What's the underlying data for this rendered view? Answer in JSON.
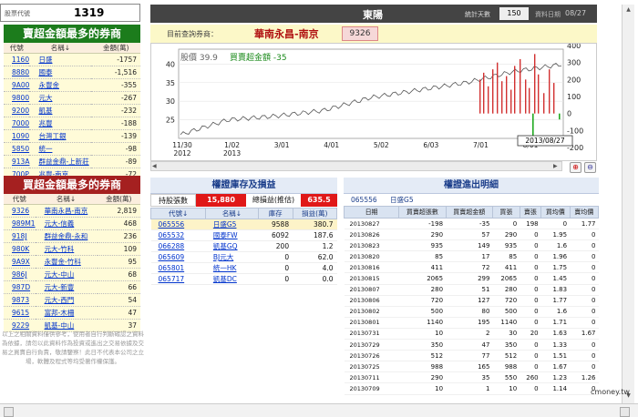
{
  "top": {
    "label": "股票代號",
    "code": "1319"
  },
  "sell_panel": {
    "title": "賣超金額最多的券商",
    "headers": [
      "代號",
      "名稱↓",
      "金額(萬)"
    ],
    "rows": [
      [
        "1160",
        "日盛",
        "-1757"
      ],
      [
        "8880",
        "國泰",
        "-1,516"
      ],
      [
        "9A00",
        "永豐金",
        "-355"
      ],
      [
        "9800",
        "元大",
        "-267"
      ],
      [
        "9200",
        "凱基",
        "-232"
      ],
      [
        "7000",
        "兆豐",
        "-188"
      ],
      [
        "1090",
        "台灣工銀",
        "-139"
      ],
      [
        "5850",
        "統一",
        "-98"
      ],
      [
        "913A",
        "群益金鼎-上新莊",
        "-89"
      ],
      [
        "700P",
        "兆豐-南京",
        "-72"
      ]
    ]
  },
  "buy_panel": {
    "title": "買超金額最多的券商",
    "headers": [
      "代號",
      "名稱↓",
      "金額(萬)"
    ],
    "rows": [
      [
        "9326",
        "華南永昌-南京",
        "2,819"
      ],
      [
        "989M1",
        "元大-信義",
        "468"
      ],
      [
        "918J",
        "群益金鼎-永和",
        "236"
      ],
      [
        "980K",
        "元大-竹科",
        "109"
      ],
      [
        "9A9X",
        "永豐金-竹科",
        "95"
      ],
      [
        "986J",
        "元大-中山",
        "68"
      ],
      [
        "987D",
        "元大-新豐",
        "66"
      ],
      [
        "9873",
        "元大-西門",
        "54"
      ],
      [
        "9615",
        "富邦-木柵",
        "47"
      ],
      [
        "9229",
        "凱基-中山",
        "37"
      ]
    ]
  },
  "disclaimer": "以上之相關資料僅供參考，使用者自行判斷確認之資料為依據，請勿以此資料作為投資或進出之交易依據及交易之買賣自行負責，敬請鑒察！此日不代表本公司之立場，軟體及程式等均受著作權保護。",
  "title_bar": {
    "name": "東陽",
    "stat_days_label": "統計天數",
    "stat_days": "150",
    "date_label": "資料日期",
    "date": "08/27"
  },
  "query": {
    "label": "目前查詢券商：",
    "broker": "華南永昌-南京",
    "code": "9326"
  },
  "chart": {
    "legend_price": "股價 39.9",
    "legend_amount": "買賣超金額 -35",
    "x_labels": [
      "11/30\n2012",
      "1/02\n2013",
      "3/01",
      "4/01",
      "5/02",
      "6/03",
      "7/01",
      "8/01"
    ],
    "date_box": "2013/08/27",
    "y_left": [
      "40",
      "35",
      "30",
      "25"
    ],
    "y_right": [
      "400",
      "300",
      "200",
      "100",
      "0",
      "-100",
      "-200"
    ]
  },
  "chart_data": {
    "type": "line",
    "x": [
      "11/30/2012",
      "1/02/2013",
      "3/01",
      "4/01",
      "5/02",
      "6/03",
      "7/01",
      "8/01",
      "8/27"
    ],
    "series": [
      {
        "values": [
          21,
          25,
          26,
          27.5,
          31,
          33,
          35,
          38,
          39.9
        ]
      },
      {
        "values": [
          0,
          0,
          0,
          0,
          0,
          0,
          200,
          300,
          -35
        ]
      }
    ],
    "ylim": [
      20,
      44
    ],
    "ylim_right": [
      -200,
      400
    ],
    "grid": true
  },
  "inventory": {
    "title": "權證庫存及損益",
    "count_label": "持股張數",
    "count": "15,880",
    "pnl_label": "總損益(推估)",
    "pnl": "635.5",
    "headers": [
      "代號↓",
      "名稱↓",
      "庫存",
      "損益(萬)"
    ],
    "rows": [
      [
        "065556",
        "日盛G5",
        "9588",
        "380.7"
      ],
      [
        "065532",
        "國泰FW",
        "6092",
        "187.6"
      ],
      [
        "066288",
        "凱基GQ",
        "200",
        "1.2"
      ],
      [
        "065609",
        "BJ元大",
        "0",
        "62.0"
      ],
      [
        "065801",
        "統一HK",
        "0",
        "4.0"
      ],
      [
        "065717",
        "凱基DC",
        "0",
        "0.0"
      ]
    ]
  },
  "detail": {
    "title": "權證進出明細",
    "sel_code": "065556",
    "sel_name": "日盛G5",
    "headers": [
      "日期",
      "買賣超張數",
      "買賣超金額",
      "買張",
      "賣張",
      "買均價",
      "賣均價"
    ],
    "rows": [
      [
        "20130827",
        "-198",
        "-35",
        "0",
        "198",
        "0",
        "1.77"
      ],
      [
        "20130826",
        "290",
        "57",
        "290",
        "0",
        "1.95",
        "0"
      ],
      [
        "20130823",
        "935",
        "149",
        "935",
        "0",
        "1.6",
        "0"
      ],
      [
        "20130820",
        "85",
        "17",
        "85",
        "0",
        "1.96",
        "0"
      ],
      [
        "20130816",
        "411",
        "72",
        "411",
        "0",
        "1.75",
        "0"
      ],
      [
        "20130815",
        "2065",
        "299",
        "2065",
        "0",
        "1.45",
        "0"
      ],
      [
        "20130807",
        "280",
        "51",
        "280",
        "0",
        "1.83",
        "0"
      ],
      [
        "20130806",
        "720",
        "127",
        "720",
        "0",
        "1.77",
        "0"
      ],
      [
        "20130802",
        "500",
        "80",
        "500",
        "0",
        "1.6",
        "0"
      ],
      [
        "20130801",
        "1140",
        "195",
        "1140",
        "0",
        "1.71",
        "0"
      ],
      [
        "20130731",
        "10",
        "2",
        "30",
        "20",
        "1.63",
        "1.67"
      ],
      [
        "20130729",
        "350",
        "47",
        "350",
        "0",
        "1.33",
        "0"
      ],
      [
        "20130726",
        "512",
        "77",
        "512",
        "0",
        "1.51",
        "0"
      ],
      [
        "20130725",
        "988",
        "165",
        "988",
        "0",
        "1.67",
        "0"
      ],
      [
        "20130711",
        "290",
        "35",
        "550",
        "260",
        "1.23",
        "1.26"
      ],
      [
        "20130709",
        "10",
        "1",
        "10",
        "0",
        "1.14",
        "0"
      ]
    ]
  },
  "watermark": "cmoney.tw"
}
